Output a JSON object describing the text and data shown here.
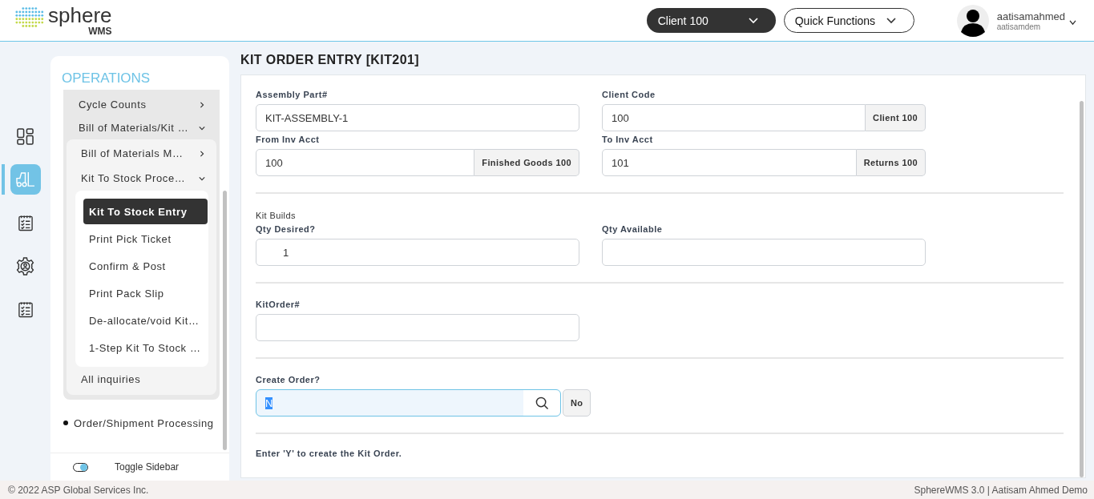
{
  "header": {
    "logo": {
      "name": "sphere",
      "sub": "WMS"
    },
    "client_select": "Client 100",
    "quick_functions": "Quick Functions",
    "user": {
      "name": "aatisamahmed",
      "account": "aatisamdem"
    }
  },
  "rail": [
    {
      "kind": "dashboard",
      "selected": false
    },
    {
      "kind": "forklift",
      "selected": true
    },
    {
      "kind": "checklist",
      "selected": false
    },
    {
      "kind": "gear",
      "selected": false
    },
    {
      "kind": "checklist",
      "selected": false
    }
  ],
  "sidebar": {
    "title": "OPERATIONS",
    "group": [
      {
        "label": "Cycle Counts",
        "expanded": false,
        "selected": false
      },
      {
        "label": "Bill of Materials/Kit …",
        "expanded": true,
        "selected": false,
        "children": [
          {
            "label": "Bill of Materials M…",
            "expanded": false,
            "selected": false
          },
          {
            "label": "Kit To Stock Proce…",
            "expanded": true,
            "selected": false,
            "children": [
              {
                "label": "Kit To Stock Entry",
                "selected": true
              },
              {
                "label": "Print Pick Ticket",
                "selected": false
              },
              {
                "label": "Confirm & Post",
                "selected": false
              },
              {
                "label": "Print Pack Slip",
                "selected": false
              },
              {
                "label": "De-allocate/void Kit…",
                "selected": false
              },
              {
                "label": "1-Step Kit To Stock …",
                "selected": false
              }
            ]
          },
          {
            "label": "All inquiries",
            "selected": false
          }
        ]
      }
    ],
    "sections": [
      {
        "label": "Order/Shipment Processing",
        "selected": false
      }
    ],
    "toggle": {
      "label": "Toggle Sidebar",
      "on": true
    }
  },
  "page_title": "KIT ORDER ENTRY [KIT201]",
  "form": [
    {
      "fields": [
        {
          "kind": "text",
          "label": "Assembly Part#",
          "value": "KIT-ASSEMBLY-1"
        },
        {
          "kind": "text",
          "label": "Client Code",
          "value": "100",
          "addon": "Client 100"
        },
        {
          "kind": "text",
          "label": "From Inv Acct",
          "value": "100",
          "addon": "Finished Goods 100"
        },
        {
          "kind": "text",
          "label": "To Inv Acct",
          "value": "101",
          "addon": "Returns 100"
        }
      ]
    },
    {
      "heading": "Kit Builds",
      "fields": [
        {
          "kind": "number",
          "label": "Qty Desired?",
          "value": "1"
        },
        {
          "kind": "text",
          "label": "Qty Available"
        }
      ]
    },
    {
      "fields": [
        {
          "kind": "text",
          "label": "KitOrder#"
        }
      ]
    },
    {
      "fields": [
        {
          "kind": "lookup",
          "label": "Create Order?",
          "value": "N",
          "focused": true,
          "value_selected": true,
          "addon": "No"
        }
      ]
    },
    {
      "hint": "Enter 'Y' to create the Kit Order."
    }
  ],
  "footer": {
    "copyright": "© 2022 ASP Global Services Inc.",
    "version": "SphereWMS 3.0 | Aatisam Ahmed Demo"
  }
}
